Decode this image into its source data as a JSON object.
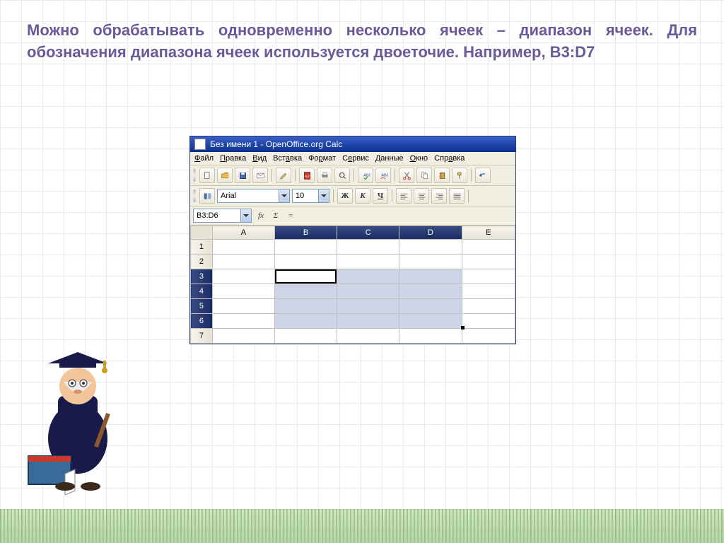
{
  "paragraph": "Можно обрабатывать одновременно несколько ячеек – диапазон ячеек. Для обозначения диапазона ячеек используется двоеточие. Например, B3:D7",
  "window": {
    "title": "Без имени 1 - OpenOffice.org Calc"
  },
  "menu": {
    "file": "Файл",
    "edit": "Правка",
    "view": "Вид",
    "insert": "Вставка",
    "format": "Формат",
    "tools": "Сервис",
    "data": "Данные",
    "window": "Окно",
    "help": "Справка"
  },
  "toolbar2": {
    "font": "Arial",
    "size": "10",
    "bold": "Ж",
    "italic": "К",
    "underline": "Ч"
  },
  "fx": {
    "namebox": "B3:D6",
    "fx_label": "fx",
    "sigma": "Σ",
    "eq": "="
  },
  "sheet": {
    "cols": [
      "A",
      "B",
      "C",
      "D",
      "E"
    ],
    "rows": [
      "1",
      "2",
      "3",
      "4",
      "5",
      "6",
      "7"
    ],
    "selected_cols": [
      "B",
      "C",
      "D"
    ],
    "selected_rows": [
      "3",
      "4",
      "5",
      "6"
    ],
    "active": "B3"
  }
}
